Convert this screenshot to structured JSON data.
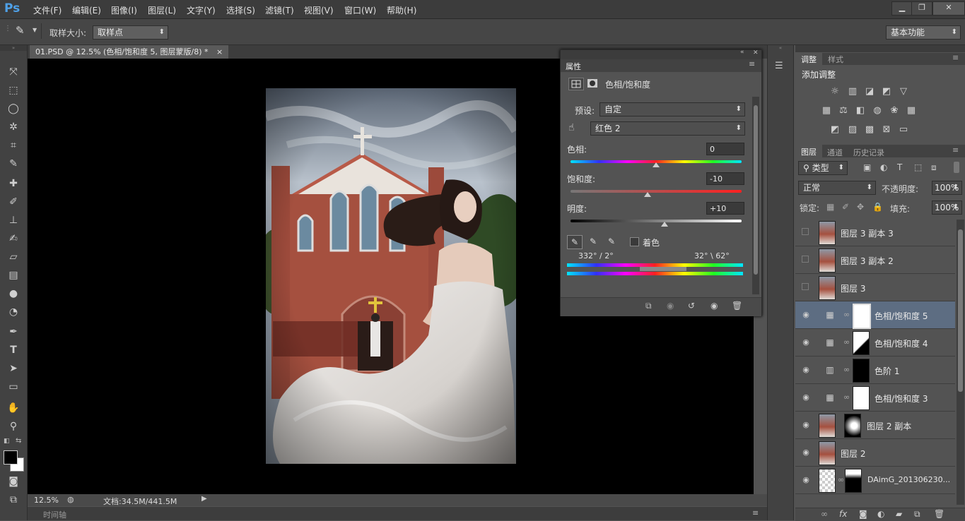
{
  "app": {
    "logo": "Ps"
  },
  "menu": [
    "文件(F)",
    "编辑(E)",
    "图像(I)",
    "图层(L)",
    "文字(Y)",
    "选择(S)",
    "滤镜(T)",
    "视图(V)",
    "窗口(W)",
    "帮助(H)"
  ],
  "window_controls": {
    "minimize": "▁",
    "restore": "❐",
    "close": "✕"
  },
  "options": {
    "sample_size_label": "取样大小:",
    "sample_size_value": "取样点",
    "workspace": "基本功能"
  },
  "document": {
    "tab_title": "01.PSD @ 12.5% (色相/饱和度 5, 图层蒙版/8) *",
    "tab_close": "×",
    "zoom": "12.5%",
    "doc_size": "文档:34.5M/441.5M",
    "timeline_label": "时间轴"
  },
  "properties": {
    "panel_title": "属性",
    "adjustment_title": "色相/饱和度",
    "preset_label": "预设:",
    "preset_value": "自定",
    "channel_value": "红色 2",
    "hue_label": "色相:",
    "hue_value": "0",
    "hue_fraction": 0.5,
    "saturation_label": "饱和度:",
    "saturation_value": "-10",
    "saturation_fraction": 0.45,
    "lightness_label": "明度:",
    "lightness_value": "+10",
    "lightness_fraction": 0.55,
    "colorize_label": "着色",
    "range_left": "332° / 2°",
    "range_right": "32° \\ 62°"
  },
  "adjustments": {
    "tab_adjust": "调整",
    "tab_styles": "样式",
    "add_label": "添加调整"
  },
  "layers_panel": {
    "tab_layers": "图层",
    "tab_channels": "通道",
    "tab_history": "历史记录",
    "filter_type": "类型",
    "blend_mode": "正常",
    "opacity_label": "不透明度:",
    "opacity_value": "100%",
    "lock_label": "锁定:",
    "fill_label": "填充:",
    "fill_value": "100%",
    "layers": [
      {
        "name": "图层 3 副本 3",
        "visible": false,
        "kind": "pixel"
      },
      {
        "name": "图层 3 副本 2",
        "visible": false,
        "kind": "pixel"
      },
      {
        "name": "图层 3",
        "visible": false,
        "kind": "pixel"
      },
      {
        "name": "色相/饱和度 5",
        "visible": true,
        "kind": "adjust",
        "selected": true
      },
      {
        "name": "色相/饱和度 4",
        "visible": true,
        "kind": "adjust"
      },
      {
        "name": "色阶 1",
        "visible": true,
        "kind": "levels"
      },
      {
        "name": "色相/饱和度 3",
        "visible": true,
        "kind": "adjust"
      },
      {
        "name": "图层 2 副本",
        "visible": true,
        "kind": "pixelmask"
      },
      {
        "name": "图层 2",
        "visible": true,
        "kind": "pixel"
      },
      {
        "name": "DAimG_201306230...",
        "visible": true,
        "kind": "smartmask"
      }
    ]
  }
}
